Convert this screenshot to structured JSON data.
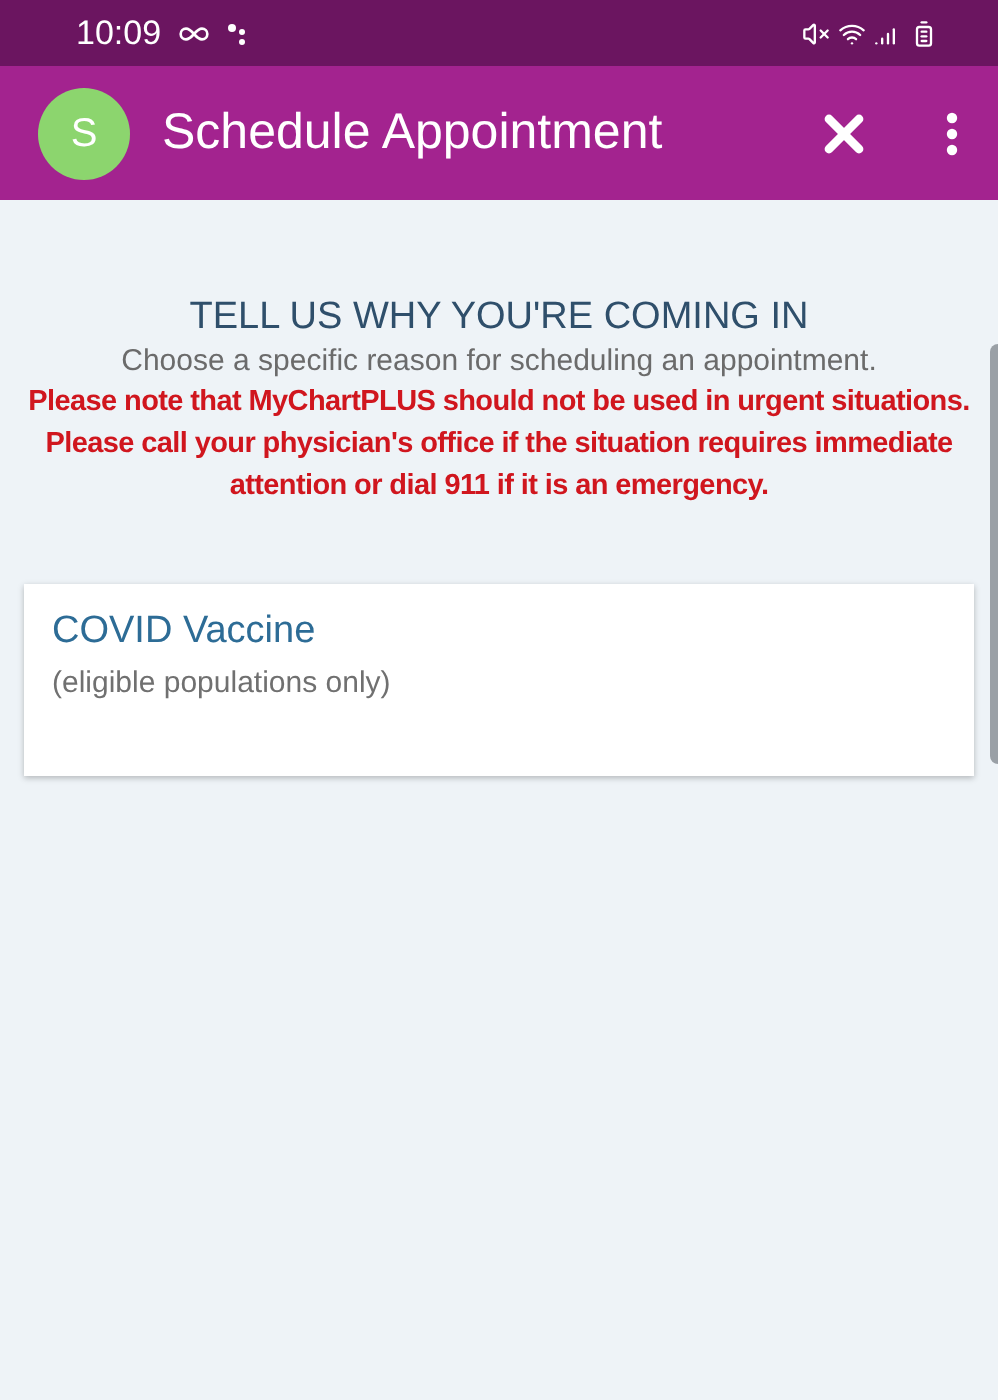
{
  "status_bar": {
    "time": "10:09"
  },
  "app_bar": {
    "avatar_letter": "S",
    "title": "Schedule Appointment"
  },
  "heading": "TELL US WHY YOU'RE COMING IN",
  "instruction": "Choose a specific reason for scheduling an appointment.",
  "warning": "Please note that MyChartPLUS should not be used in urgent situations. Please call your physician's office if the situation requires immediate attention or dial 911 if it is an emergency.",
  "reasons": [
    {
      "title": "COVID Vaccine",
      "subtitle": "(eligible populations only)"
    }
  ]
}
